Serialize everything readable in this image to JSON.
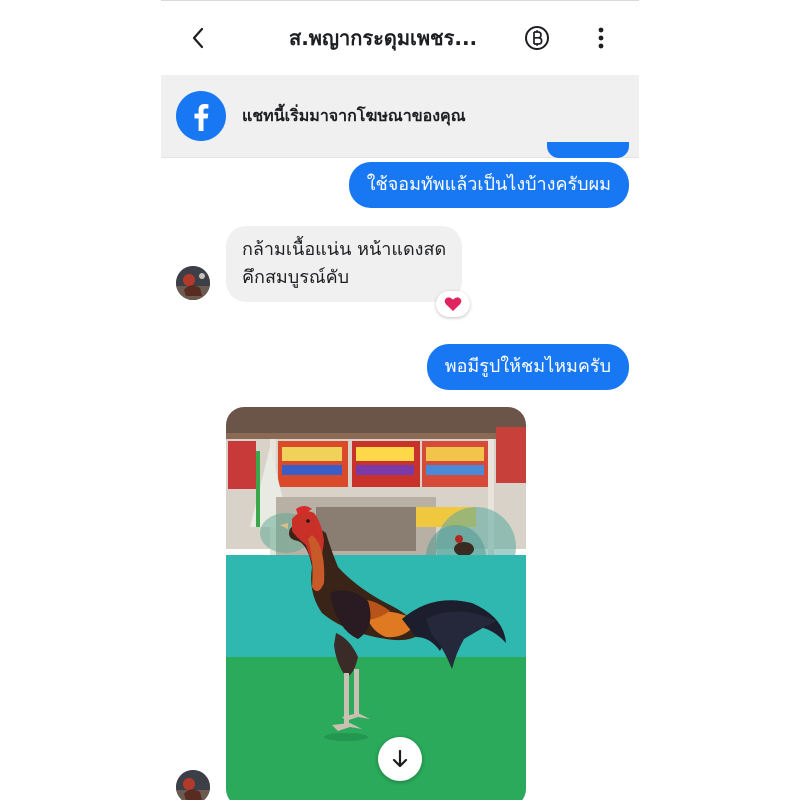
{
  "header": {
    "title": "ส.พญากระดุมเพชร...",
    "back_icon": "chevron-left-icon",
    "currency_icon": "baht-icon",
    "more_icon": "vertical-dots-icon"
  },
  "ad_banner": {
    "icon": "facebook-icon",
    "text": "แชทนี้เริ่มมาจากโฆษณาของคุณ"
  },
  "messages": [
    {
      "direction": "outgoing",
      "text": "ใช้จอมทัพแล้วเป็นไงบ้างครับผม"
    },
    {
      "direction": "incoming",
      "lines": [
        "กล้ามเนื้อแน่น หน้าแดงสด",
        "คึกสมบูรณ์คับ"
      ],
      "reaction": "heart-icon"
    },
    {
      "direction": "outgoing",
      "text": "พอมีรูปให้ชมไหมครับ"
    },
    {
      "direction": "incoming",
      "type": "image",
      "image_icon": "rooster-photo",
      "download_icon": "arrow-down-icon"
    }
  ],
  "colors": {
    "accent": "#1877f2",
    "incoming_bubble": "#f0f0f0",
    "reaction_heart": "#e0245e"
  }
}
